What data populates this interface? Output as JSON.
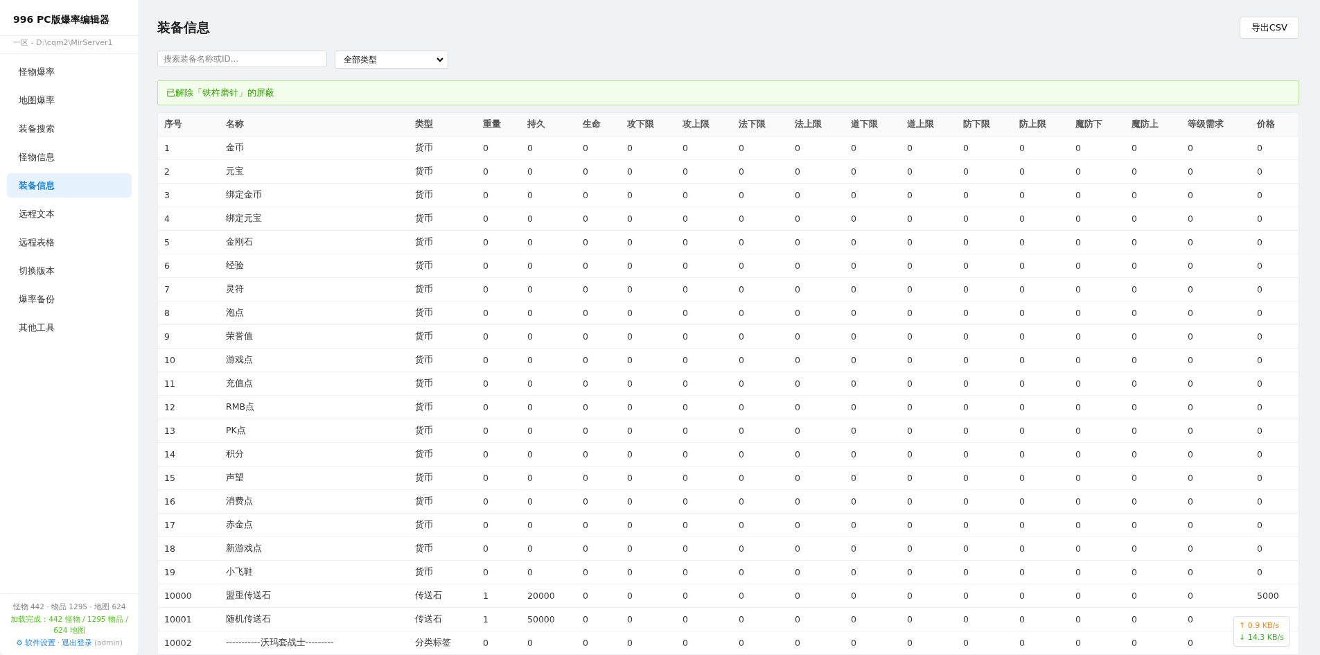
{
  "sidebar": {
    "title": "996 PC版爆率编辑器",
    "subtitle": "一区 - D:\\cqm2\\MirServer1",
    "items": [
      {
        "label": "怪物爆率",
        "selected": false
      },
      {
        "label": "地图爆率",
        "selected": false
      },
      {
        "label": "装备搜索",
        "selected": false
      },
      {
        "label": "怪物信息",
        "selected": false
      },
      {
        "label": "装备信息",
        "selected": true
      },
      {
        "label": "远程文本",
        "selected": false
      },
      {
        "label": "远程表格",
        "selected": false
      },
      {
        "label": "切换版本",
        "selected": false
      },
      {
        "label": "爆率备份",
        "selected": false
      },
      {
        "label": "其他工具",
        "selected": false
      }
    ],
    "footer": {
      "stats": "怪物 442 · 物品 1295 · 地图 624",
      "load_status": "加载完成：442 怪物 / 1295 物品 / 624 地图",
      "settings_link": "⚙ 软件设置",
      "separator": "·",
      "logout_link": "退出登录",
      "user": "(admin)"
    }
  },
  "header": {
    "title": "装备信息",
    "export_button": "导出CSV"
  },
  "filters": {
    "search": {
      "placeholder": "搜索装备名称或ID..."
    },
    "type_select": {
      "value": "全部类型"
    }
  },
  "alert": {
    "text": "已解除「铁杵磨针」的屏蔽"
  },
  "table": {
    "columns": [
      "序号",
      "名称",
      "类型",
      "重量",
      "持久",
      "生命",
      "攻下限",
      "攻上限",
      "法下限",
      "法上限",
      "道下限",
      "道上限",
      "防下限",
      "防上限",
      "魔防下",
      "魔防上",
      "等级需求",
      "价格"
    ],
    "rows": [
      [
        "1",
        "金币",
        "货币",
        "0",
        "0",
        "0",
        "0",
        "0",
        "0",
        "0",
        "0",
        "0",
        "0",
        "0",
        "0",
        "0",
        "0",
        "0"
      ],
      [
        "2",
        "元宝",
        "货币",
        "0",
        "0",
        "0",
        "0",
        "0",
        "0",
        "0",
        "0",
        "0",
        "0",
        "0",
        "0",
        "0",
        "0",
        "0"
      ],
      [
        "3",
        "绑定金币",
        "货币",
        "0",
        "0",
        "0",
        "0",
        "0",
        "0",
        "0",
        "0",
        "0",
        "0",
        "0",
        "0",
        "0",
        "0",
        "0"
      ],
      [
        "4",
        "绑定元宝",
        "货币",
        "0",
        "0",
        "0",
        "0",
        "0",
        "0",
        "0",
        "0",
        "0",
        "0",
        "0",
        "0",
        "0",
        "0",
        "0"
      ],
      [
        "5",
        "金刚石",
        "货币",
        "0",
        "0",
        "0",
        "0",
        "0",
        "0",
        "0",
        "0",
        "0",
        "0",
        "0",
        "0",
        "0",
        "0",
        "0"
      ],
      [
        "6",
        "经验",
        "货币",
        "0",
        "0",
        "0",
        "0",
        "0",
        "0",
        "0",
        "0",
        "0",
        "0",
        "0",
        "0",
        "0",
        "0",
        "0"
      ],
      [
        "7",
        "灵符",
        "货币",
        "0",
        "0",
        "0",
        "0",
        "0",
        "0",
        "0",
        "0",
        "0",
        "0",
        "0",
        "0",
        "0",
        "0",
        "0"
      ],
      [
        "8",
        "泡点",
        "货币",
        "0",
        "0",
        "0",
        "0",
        "0",
        "0",
        "0",
        "0",
        "0",
        "0",
        "0",
        "0",
        "0",
        "0",
        "0"
      ],
      [
        "9",
        "荣誉值",
        "货币",
        "0",
        "0",
        "0",
        "0",
        "0",
        "0",
        "0",
        "0",
        "0",
        "0",
        "0",
        "0",
        "0",
        "0",
        "0"
      ],
      [
        "10",
        "游戏点",
        "货币",
        "0",
        "0",
        "0",
        "0",
        "0",
        "0",
        "0",
        "0",
        "0",
        "0",
        "0",
        "0",
        "0",
        "0",
        "0"
      ],
      [
        "11",
        "充值点",
        "货币",
        "0",
        "0",
        "0",
        "0",
        "0",
        "0",
        "0",
        "0",
        "0",
        "0",
        "0",
        "0",
        "0",
        "0",
        "0"
      ],
      [
        "12",
        "RMB点",
        "货币",
        "0",
        "0",
        "0",
        "0",
        "0",
        "0",
        "0",
        "0",
        "0",
        "0",
        "0",
        "0",
        "0",
        "0",
        "0"
      ],
      [
        "13",
        "PK点",
        "货币",
        "0",
        "0",
        "0",
        "0",
        "0",
        "0",
        "0",
        "0",
        "0",
        "0",
        "0",
        "0",
        "0",
        "0",
        "0"
      ],
      [
        "14",
        "积分",
        "货币",
        "0",
        "0",
        "0",
        "0",
        "0",
        "0",
        "0",
        "0",
        "0",
        "0",
        "0",
        "0",
        "0",
        "0",
        "0"
      ],
      [
        "15",
        "声望",
        "货币",
        "0",
        "0",
        "0",
        "0",
        "0",
        "0",
        "0",
        "0",
        "0",
        "0",
        "0",
        "0",
        "0",
        "0",
        "0"
      ],
      [
        "16",
        "消费点",
        "货币",
        "0",
        "0",
        "0",
        "0",
        "0",
        "0",
        "0",
        "0",
        "0",
        "0",
        "0",
        "0",
        "0",
        "0",
        "0"
      ],
      [
        "17",
        "赤金点",
        "货币",
        "0",
        "0",
        "0",
        "0",
        "0",
        "0",
        "0",
        "0",
        "0",
        "0",
        "0",
        "0",
        "0",
        "0",
        "0"
      ],
      [
        "18",
        "新游戏点",
        "货币",
        "0",
        "0",
        "0",
        "0",
        "0",
        "0",
        "0",
        "0",
        "0",
        "0",
        "0",
        "0",
        "0",
        "0",
        "0"
      ],
      [
        "19",
        "小飞鞋",
        "货币",
        "0",
        "0",
        "0",
        "0",
        "0",
        "0",
        "0",
        "0",
        "0",
        "0",
        "0",
        "0",
        "0",
        "0",
        "0"
      ],
      [
        "10000",
        "盟重传送石",
        "传送石",
        "1",
        "20000",
        "0",
        "0",
        "0",
        "0",
        "0",
        "0",
        "0",
        "0",
        "0",
        "0",
        "0",
        "0",
        "5000"
      ],
      [
        "10001",
        "随机传送石",
        "传送石",
        "1",
        "50000",
        "0",
        "0",
        "0",
        "0",
        "0",
        "0",
        "0",
        "0",
        "0",
        "0",
        "0",
        "0"
      ],
      [
        "10002",
        "-----------沃玛套战士---------",
        "分类标签",
        "0",
        "0",
        "0",
        "0",
        "0",
        "0",
        "0",
        "0",
        "0",
        "0",
        "0",
        "0",
        "0",
        "0"
      ]
    ]
  },
  "network_widget": {
    "upload": "↑ 0.9 KB/s",
    "download": "↓ 14.3 KB/s"
  }
}
